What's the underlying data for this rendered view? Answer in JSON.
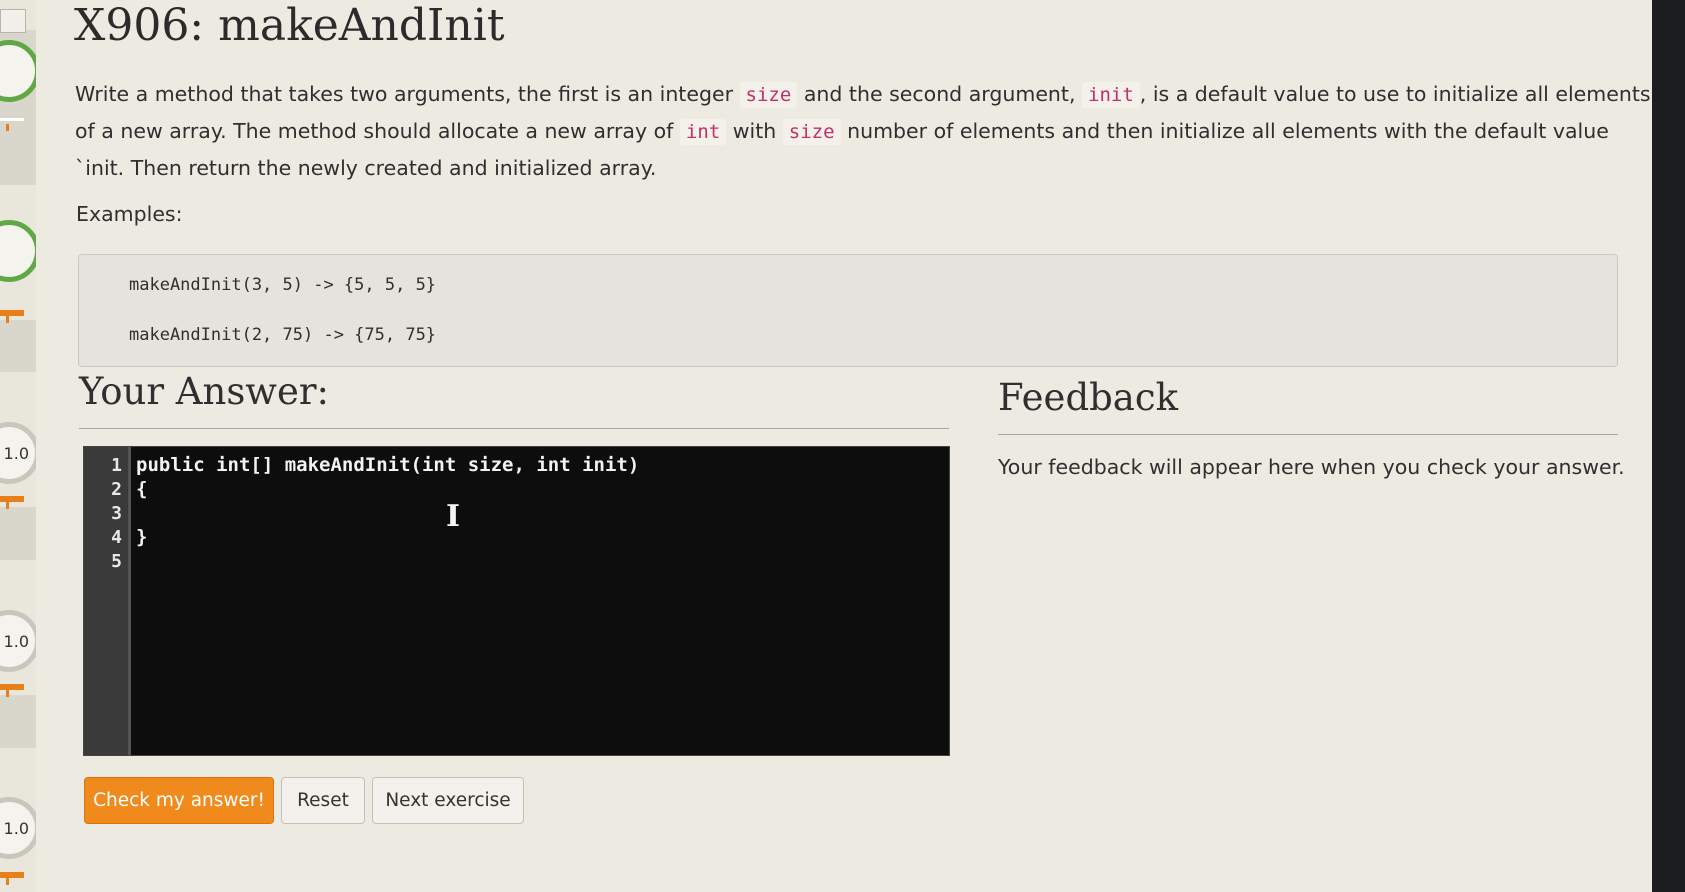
{
  "sidebar": {
    "scores": [
      "1.0",
      "1.0",
      "1.0"
    ]
  },
  "exercise": {
    "title": "X906: makeAndInit",
    "description": {
      "line1": {
        "t1": "Write a method that takes two arguments, the first is an integer",
        "c1": "size",
        "t2": "and the second argument,",
        "c2": "init",
        "t3": ", is a default value to use to initialize all elements"
      },
      "line2": {
        "t1": "of a new array. The method should allocate a new array of",
        "c1": "int",
        "t2": "with",
        "c2": "size",
        "t3": "number of elements and then initialize all elements with the default value"
      },
      "line3": "`init. Then return the newly created and initialized array."
    },
    "examples_label": "Examples:",
    "examples": [
      "makeAndInit(3, 5) -> {5, 5, 5}",
      "makeAndInit(2, 75) -> {75, 75}"
    ]
  },
  "answer": {
    "heading": "Your Answer:",
    "line_numbers": [
      "1",
      "2",
      "3",
      "4",
      "5"
    ],
    "code_lines": [
      "public int[] makeAndInit(int size, int init)",
      "{",
      "",
      "}",
      ""
    ],
    "cursor_glyph": "I"
  },
  "buttons": {
    "check": "Check my answer!",
    "reset": "Reset",
    "next": "Next exercise"
  },
  "feedback": {
    "heading": "Feedback",
    "text": "Your feedback will appear here when you check your answer."
  },
  "colors": {
    "accent_orange": "#f08a1c",
    "code_highlight": "#c0306a",
    "progress_green": "#5fa845"
  }
}
